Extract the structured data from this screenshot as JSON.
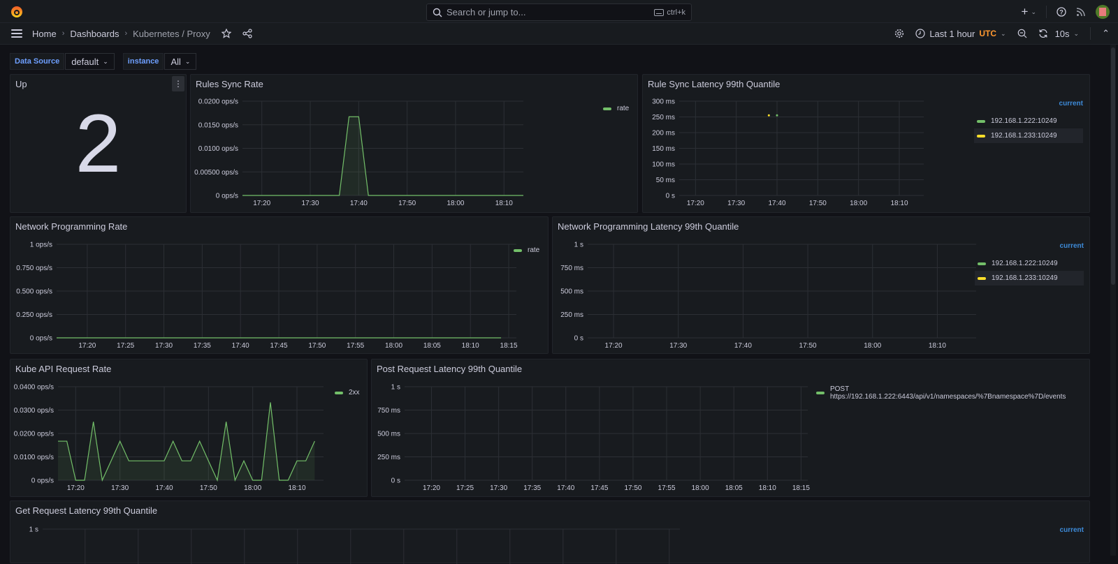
{
  "topbar": {
    "logo_icon": "grafana-logo-icon",
    "search_placeholder": "Search or jump to...",
    "search_shortcut": "ctrl+k",
    "icons": [
      "plus-icon",
      "chevron-down-icon",
      "help-icon",
      "rss-news-icon",
      "user-avatar"
    ]
  },
  "navbar": {
    "breadcrumbs": [
      "Home",
      "Dashboards",
      "Kubernetes / Proxy"
    ],
    "time_range": "Last 1 hour",
    "timezone": "UTC",
    "refresh_interval": "10s"
  },
  "variables": [
    {
      "label": "Data Source",
      "value": "default"
    },
    {
      "label": "instance",
      "value": "All"
    }
  ],
  "colors": {
    "green": "#73bf69",
    "yellow": "#fade2a",
    "blue": "#3d8bd9",
    "orange": "#ff9830"
  },
  "panels": {
    "up": {
      "title": "Up",
      "value": "2"
    },
    "rules_sync_rate": {
      "title": "Rules Sync Rate"
    },
    "rule_sync_latency": {
      "title": "Rule Sync Latency 99th Quantile"
    },
    "network_programming_rate": {
      "title": "Network Programming Rate"
    },
    "network_programming_latency": {
      "title": "Network Programming Latency 99th Quantile"
    },
    "kube_api_request_rate": {
      "title": "Kube API Request Rate"
    },
    "post_request_latency": {
      "title": "Post Request Latency 99th Quantile"
    },
    "get_request_latency": {
      "title": "Get Request Latency 99th Quantile"
    }
  },
  "chart_data": [
    {
      "id": "rules_sync_rate",
      "type": "area",
      "title": "Rules Sync Rate",
      "x_ticks": [
        "17:20",
        "17:30",
        "17:40",
        "17:50",
        "18:00",
        "18:10"
      ],
      "x_range_min": [
        16,
        74
      ],
      "y_ticks": [
        "0 ops/s",
        "0.00500 ops/s",
        "0.0100 ops/s",
        "0.0150 ops/s",
        "0.0200 ops/s"
      ],
      "ylim": [
        0,
        0.02
      ],
      "legend_header": "",
      "series": [
        {
          "name": "rate",
          "color": "#73bf69",
          "points": [
            [
              16,
              0
            ],
            [
              36,
              0
            ],
            [
              38,
              0.0167
            ],
            [
              40,
              0.0167
            ],
            [
              42,
              0
            ],
            [
              74,
              0
            ]
          ]
        }
      ]
    },
    {
      "id": "rule_sync_latency",
      "type": "scatter",
      "title": "Rule Sync Latency 99th Quantile",
      "x_ticks": [
        "17:20",
        "17:30",
        "17:40",
        "17:50",
        "18:00",
        "18:10"
      ],
      "x_range_min": [
        16,
        76
      ],
      "y_ticks": [
        "0 s",
        "50 ms",
        "100 ms",
        "150 ms",
        "200 ms",
        "250 ms",
        "300 ms"
      ],
      "ylim": [
        0,
        300
      ],
      "legend_header": "current",
      "series": [
        {
          "name": "192.168.1.222:10249",
          "color": "#73bf69",
          "points": [
            [
              40,
              255
            ]
          ]
        },
        {
          "name": "192.168.1.233:10249",
          "color": "#fade2a",
          "points": [
            [
              38,
              255
            ]
          ]
        }
      ]
    },
    {
      "id": "network_programming_rate",
      "type": "line",
      "title": "Network Programming Rate",
      "x_ticks": [
        "17:20",
        "17:25",
        "17:30",
        "17:35",
        "17:40",
        "17:45",
        "17:50",
        "17:55",
        "18:00",
        "18:05",
        "18:10",
        "18:15"
      ],
      "x_range_min": [
        16,
        76
      ],
      "y_ticks": [
        "0 ops/s",
        "0.250 ops/s",
        "0.500 ops/s",
        "0.750 ops/s",
        "1 ops/s"
      ],
      "ylim": [
        0,
        1
      ],
      "legend_header": "",
      "series": [
        {
          "name": "rate",
          "color": "#73bf69",
          "points": [
            [
              16,
              0
            ],
            [
              74,
              0
            ]
          ]
        }
      ]
    },
    {
      "id": "network_programming_latency",
      "type": "line",
      "title": "Network Programming Latency 99th Quantile",
      "x_ticks": [
        "17:20",
        "17:30",
        "17:40",
        "17:50",
        "18:00",
        "18:10"
      ],
      "x_range_min": [
        16,
        76
      ],
      "y_ticks": [
        "0 s",
        "250 ms",
        "500 ms",
        "750 ms",
        "1 s"
      ],
      "ylim": [
        0,
        1000
      ],
      "legend_header": "current",
      "series": [
        {
          "name": "192.168.1.222:10249",
          "color": "#73bf69",
          "points": []
        },
        {
          "name": "192.168.1.233:10249",
          "color": "#fade2a",
          "points": []
        }
      ]
    },
    {
      "id": "kube_api_request_rate",
      "type": "area",
      "title": "Kube API Request Rate",
      "x_ticks": [
        "17:20",
        "17:30",
        "17:40",
        "17:50",
        "18:00",
        "18:10"
      ],
      "x_range_min": [
        16,
        76
      ],
      "y_ticks": [
        "0 ops/s",
        "0.0100 ops/s",
        "0.0200 ops/s",
        "0.0300 ops/s",
        "0.0400 ops/s"
      ],
      "ylim": [
        0,
        0.04
      ],
      "legend_header": "",
      "series": [
        {
          "name": "2xx",
          "color": "#73bf69",
          "points": [
            [
              16,
              0.0167
            ],
            [
              18,
              0.0167
            ],
            [
              20,
              0
            ],
            [
              22,
              0
            ],
            [
              24,
              0.025
            ],
            [
              26,
              0
            ],
            [
              28,
              0.0083
            ],
            [
              30,
              0.0167
            ],
            [
              32,
              0.0083
            ],
            [
              34,
              0.0083
            ],
            [
              36,
              0.0083
            ],
            [
              38,
              0.0083
            ],
            [
              40,
              0.0083
            ],
            [
              42,
              0.0167
            ],
            [
              44,
              0.0083
            ],
            [
              46,
              0.0083
            ],
            [
              48,
              0.0167
            ],
            [
              50,
              0.0083
            ],
            [
              52,
              0
            ],
            [
              54,
              0.025
            ],
            [
              56,
              0
            ],
            [
              58,
              0.0083
            ],
            [
              60,
              0
            ],
            [
              62,
              0
            ],
            [
              64,
              0.0333
            ],
            [
              66,
              0
            ],
            [
              68,
              0
            ],
            [
              70,
              0.0083
            ],
            [
              72,
              0.0083
            ],
            [
              74,
              0.0167
            ]
          ]
        }
      ]
    },
    {
      "id": "post_request_latency",
      "type": "line",
      "title": "Post Request Latency 99th Quantile",
      "x_ticks": [
        "17:20",
        "17:25",
        "17:30",
        "17:35",
        "17:40",
        "17:45",
        "17:50",
        "17:55",
        "18:00",
        "18:05",
        "18:10",
        "18:15"
      ],
      "x_range_min": [
        16,
        76
      ],
      "y_ticks": [
        "0 s",
        "250 ms",
        "500 ms",
        "750 ms",
        "1 s"
      ],
      "ylim": [
        0,
        1000
      ],
      "legend_header": "",
      "series": [
        {
          "name": "POST https://192.168.1.222:6443/api/v1/namespaces/%7Bnamespace%7D/events",
          "color": "#73bf69",
          "points": []
        }
      ]
    },
    {
      "id": "get_request_latency",
      "type": "line",
      "title": "Get Request Latency 99th Quantile",
      "x_ticks": [],
      "x_range_min": [
        16,
        76
      ],
      "y_ticks": [
        "1 s"
      ],
      "ylim": [
        0,
        1000
      ],
      "legend_header": "current",
      "series": []
    }
  ]
}
